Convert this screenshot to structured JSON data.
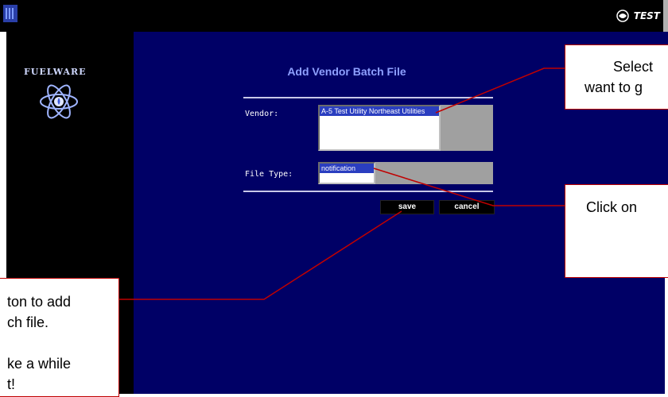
{
  "topbar": {
    "badge_label": "TEST"
  },
  "sidebar": {
    "brand": "FUELWARE"
  },
  "form": {
    "title": "Add Vendor Batch File",
    "vendor_label": "Vendor:",
    "vendor_selected": "A-5 Test Utility Northeast Utilities",
    "file_type_label": "File Type:",
    "file_type_selected": "notification",
    "save_label": "save",
    "cancel_label": "cancel"
  },
  "callouts": {
    "select_vendor": {
      "line1": "Select",
      "line2": "want to g"
    },
    "click_on": {
      "line1": "Click on"
    },
    "save_note": {
      "line1": "ton to add",
      "line2": "ch file.",
      "line3": "ke a while",
      "line4": "t!"
    }
  },
  "colors": {
    "main_bg": "#000066",
    "accent": "#8ea0ff",
    "callout_border": "#c00000"
  }
}
